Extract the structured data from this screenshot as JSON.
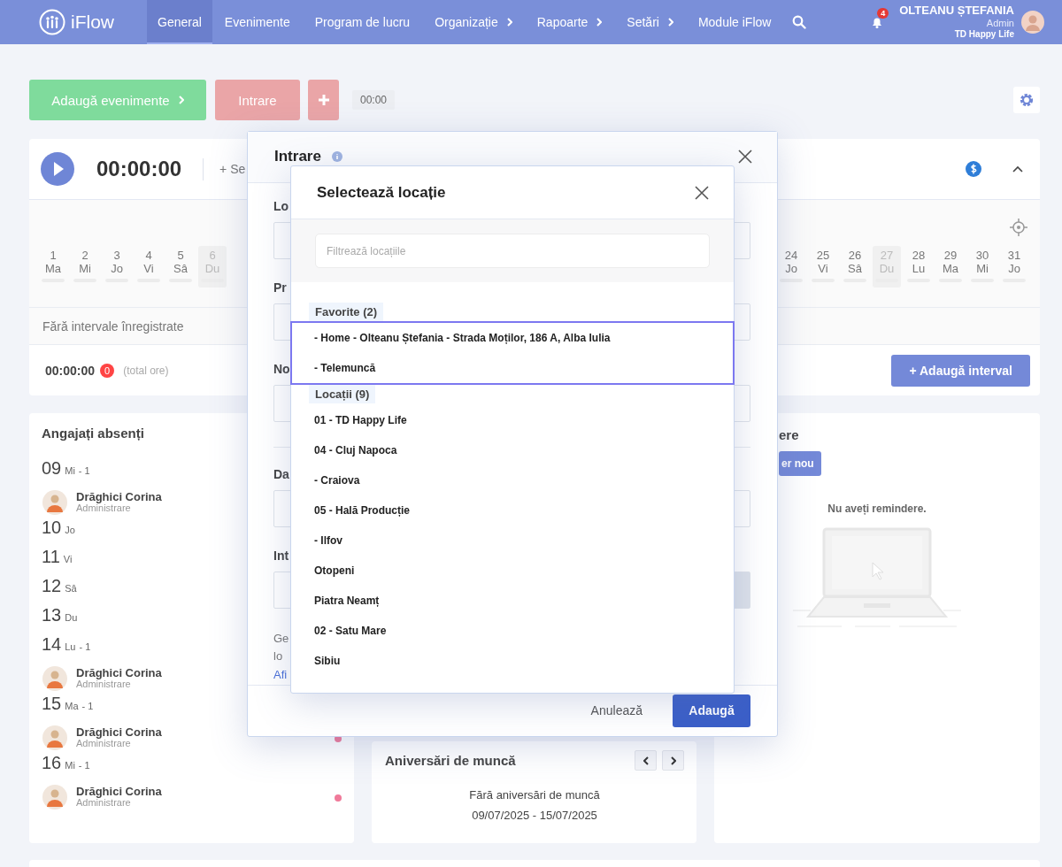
{
  "navbar": {
    "logo": "iFlow",
    "items": [
      {
        "label": "General",
        "selected": true,
        "has_submenu": false
      },
      {
        "label": "Evenimente",
        "selected": false,
        "has_submenu": false
      },
      {
        "label": "Program de lucru",
        "selected": false,
        "has_submenu": false
      },
      {
        "label": "Organizație",
        "selected": false,
        "has_submenu": true
      },
      {
        "label": "Rapoarte",
        "selected": false,
        "has_submenu": true
      },
      {
        "label": "Setări",
        "selected": false,
        "has_submenu": true
      },
      {
        "label": "Module iFlow",
        "selected": false,
        "has_submenu": false
      }
    ],
    "notifications": "4",
    "user": {
      "name": "OLTEANU ȘTEFANIA",
      "role": "Admin",
      "company": "TD Happy Life"
    }
  },
  "toolbar": {
    "add_events_button": "Adaugă evenimente",
    "entry_button": "Intrare",
    "time": "00:00"
  },
  "timer": {
    "time": "00:00:00",
    "select_link": "+ Se",
    "days_left": [
      {
        "day": "1",
        "weekday": "Ma",
        "dimmed": false
      },
      {
        "day": "2",
        "weekday": "Mi",
        "dimmed": false
      },
      {
        "day": "3",
        "weekday": "Jo",
        "dimmed": false
      },
      {
        "day": "4",
        "weekday": "Vi",
        "dimmed": false
      },
      {
        "day": "5",
        "weekday": "Sâ",
        "dimmed": false
      },
      {
        "day": "6",
        "weekday": "Du",
        "dimmed": true
      }
    ],
    "days_right": [
      {
        "day": "24",
        "weekday": "Jo",
        "dimmed": false
      },
      {
        "day": "25",
        "weekday": "Vi",
        "dimmed": false
      },
      {
        "day": "26",
        "weekday": "Sâ",
        "dimmed": false
      },
      {
        "day": "27",
        "weekday": "Du",
        "dimmed": true
      },
      {
        "day": "28",
        "weekday": "Lu",
        "dimmed": false
      },
      {
        "day": "29",
        "weekday": "Ma",
        "dimmed": false
      },
      {
        "day": "30",
        "weekday": "Mi",
        "dimmed": false
      },
      {
        "day": "31",
        "weekday": "Jo",
        "dimmed": false
      }
    ],
    "empty_text": "Fără intervale înregistrate",
    "total": "00:00:00",
    "count": "0",
    "total_label": "(total ore)",
    "add_interval_button": "+ Adaugă interval"
  },
  "absent": {
    "title": "Angajați absenți",
    "days": [
      {
        "date": "09",
        "weekday": "Mi",
        "count": "- 1",
        "people": [
          {
            "name": "Drăghici Corina",
            "department": "Administrare"
          }
        ]
      },
      {
        "date": "10",
        "weekday": "Jo"
      },
      {
        "date": "11",
        "weekday": "Vi"
      },
      {
        "date": "12",
        "weekday": "Sâ"
      },
      {
        "date": "13",
        "weekday": "Du"
      },
      {
        "date": "14",
        "weekday": "Lu",
        "count": "- 1",
        "people": [
          {
            "name": "Drăghici Corina",
            "department": "Administrare"
          }
        ]
      },
      {
        "date": "15",
        "weekday": "Ma",
        "count": "- 1",
        "people": [
          {
            "name": "Drăghici Corina",
            "department": "Administrare",
            "flagged": true
          }
        ]
      },
      {
        "date": "16",
        "weekday": "Mi",
        "count": "- 1",
        "people": [
          {
            "name": "Drăghici Corina",
            "department": "Administrare",
            "flagged": true
          }
        ]
      }
    ]
  },
  "anniversaries": {
    "title": "Aniversări de muncă",
    "empty_text": "Fără aniversări de muncă",
    "range": "09/07/2025 - 15/07/2025"
  },
  "reminders": {
    "title": "ere",
    "new_button": "er nou",
    "empty_text": "Nu aveți remindere."
  },
  "entry_dialog": {
    "title": "Intrare",
    "fields": [
      {
        "label": "Lo"
      },
      {
        "label": "Pr"
      },
      {
        "label": "No"
      },
      {
        "label": "Da"
      },
      {
        "label": "Int"
      }
    ],
    "note_lines": [
      "Ge",
      "lo"
    ],
    "link": "Afi",
    "cancel_button": "Anulează",
    "add_button": "Adaugă"
  },
  "location_dialog": {
    "title": "Selectează locație",
    "filter_placeholder": "Filtrează locațiile",
    "groups": [
      {
        "label": "Favorite (2)",
        "highlighted": true,
        "items": [
          "- Home - Olteanu Ștefania - Strada Moților, 186 A, Alba Iulia",
          "- Telemuncă"
        ]
      },
      {
        "label": "Locații (9)",
        "highlighted": false,
        "items": [
          "01 - TD Happy Life",
          "04 - Cluj Napoca",
          "- Craiova",
          "05 - Hală Producție",
          "- Ilfov",
          "Otopeni",
          "Piatra Neamț",
          "02 - Satu Mare",
          "Sibiu"
        ]
      }
    ]
  }
}
